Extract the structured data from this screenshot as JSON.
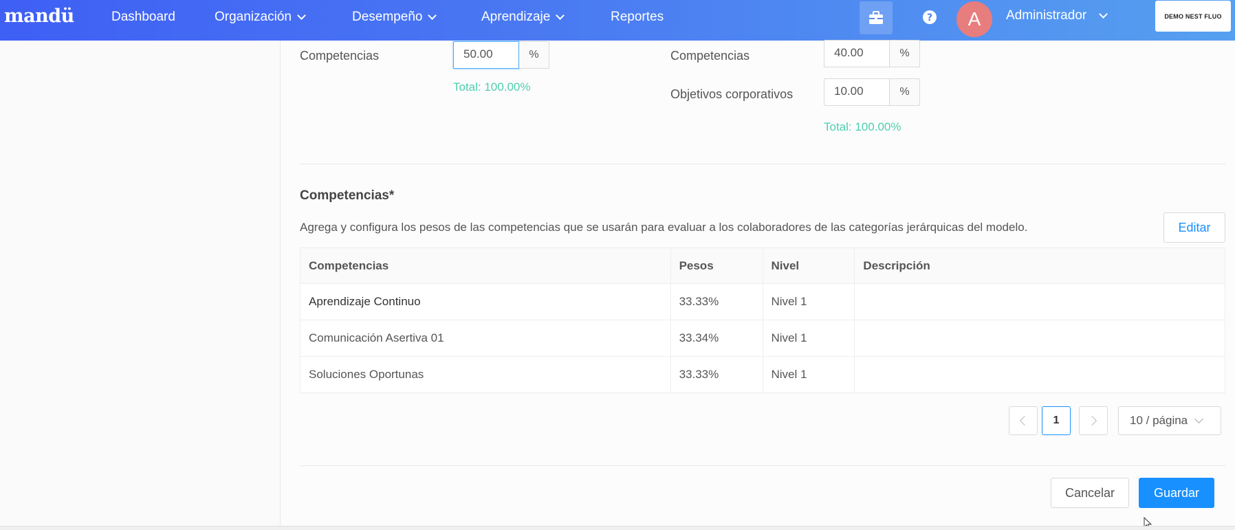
{
  "nav": {
    "logo": "mandü",
    "items": [
      {
        "label": "Dashboard",
        "has_dropdown": false
      },
      {
        "label": "Organización",
        "has_dropdown": true
      },
      {
        "label": "Desempeño",
        "has_dropdown": true
      },
      {
        "label": "Aprendizaje",
        "has_dropdown": true
      },
      {
        "label": "Reportes",
        "has_dropdown": false
      }
    ],
    "icons": [
      "briefcase-icon",
      "help-icon",
      "bell-icon"
    ],
    "avatar_letter": "A",
    "user_name": "Administrador",
    "brand": "DEMO NEST FLUO"
  },
  "weights_left": {
    "label": "Competencias",
    "value": "50.00",
    "unit": "%",
    "total": "Total: 100.00%"
  },
  "weights_right": {
    "rows": [
      {
        "label": "Competencias",
        "value": "40.00",
        "unit": "%"
      },
      {
        "label": "Objetivos corporativos",
        "value": "10.00",
        "unit": "%"
      }
    ],
    "total": "Total: 100.00%"
  },
  "competencias": {
    "title": "Competencias*",
    "description": "Agrega y configura los pesos de las competencias que se usarán para evaluar a los colaboradores de las categorías jerárquicas del modelo.",
    "edit_label": "Editar",
    "columns": [
      "Competencias",
      "Pesos",
      "Nivel",
      "Descripción"
    ],
    "rows": [
      {
        "name": "Aprendizaje Continuo",
        "weight": "33.33%",
        "level": "Nivel 1",
        "description": ""
      },
      {
        "name": "Comunicación Asertiva 01",
        "weight": "33.34%",
        "level": "Nivel 1",
        "description": ""
      },
      {
        "name": "Soluciones Oportunas",
        "weight": "33.33%",
        "level": "Nivel 1",
        "description": ""
      }
    ]
  },
  "pagination": {
    "current_page": "1",
    "page_size": "10 / página"
  },
  "actions": {
    "cancel_label": "Cancelar",
    "save_label": "Guardar"
  },
  "colors": {
    "nav_gradient_start": "#3f5ff5",
    "nav_gradient_end": "#56a0f0",
    "primary": "#1890ff",
    "total_text": "#4ecfb0",
    "avatar_bg": "#e87d7d"
  }
}
